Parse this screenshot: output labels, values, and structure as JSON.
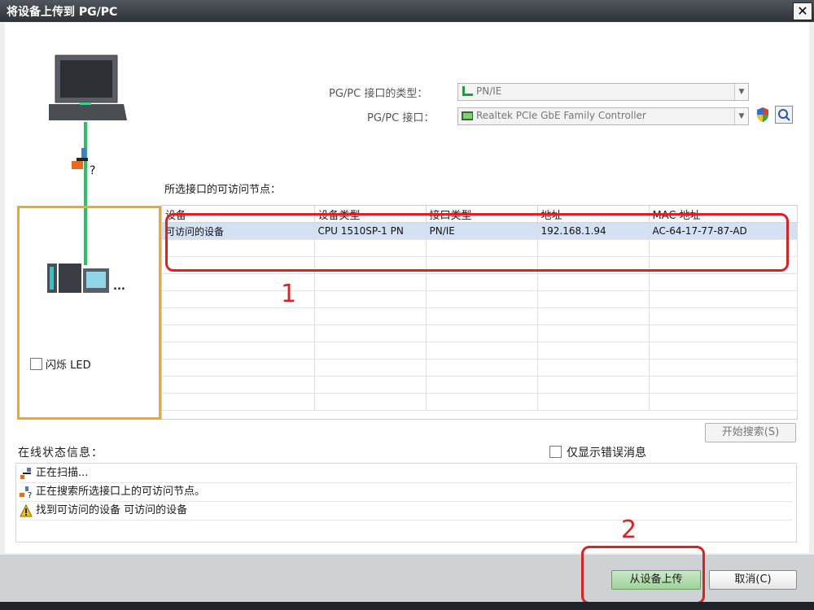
{
  "dialog": {
    "title": "将设备上传到 PG/PC",
    "close_glyph": "✕"
  },
  "interface": {
    "type_label": "PG/PC 接口的类型：",
    "type_value": "PN/IE",
    "interface_label": "PG/PC 接口：",
    "interface_value": "Realtek PCIe GbE Family Controller"
  },
  "nodes": {
    "title": "所选接口的可访问节点：",
    "columns": [
      "设备",
      "设备类型",
      "接口类型",
      "地址",
      "MAC 地址"
    ],
    "rows": [
      {
        "device": "可访问的设备",
        "device_type": "CPU 1510SP-1 PN",
        "interface_type": "PN/IE",
        "address": "192.168.1.94",
        "mac": "AC-64-17-77-87-AD"
      }
    ]
  },
  "device_panel": {
    "flash_led_label": "闪烁 LED",
    "device_icon_suffix": "..."
  },
  "search_button": "开始搜索(S)",
  "status": {
    "title": "在线状态信息：",
    "errors_only_label": "仅显示错误消息",
    "messages": [
      {
        "icon": "network-scan-icon",
        "text": "正在扫描..."
      },
      {
        "icon": "network-search-icon",
        "text": "正在搜索所选接口上的可访问节点。"
      },
      {
        "icon": "warning-icon",
        "text": "找到可访问的设备 可访问的设备"
      }
    ]
  },
  "buttons": {
    "upload": "从设备上传",
    "cancel": "取消(C)"
  },
  "annotations": {
    "one": "1",
    "two": "2"
  },
  "colors": {
    "highlight": "#e02020",
    "orange": "#f5a623",
    "link_green": "#22c55e",
    "selected_row": "#d3e1f3"
  }
}
